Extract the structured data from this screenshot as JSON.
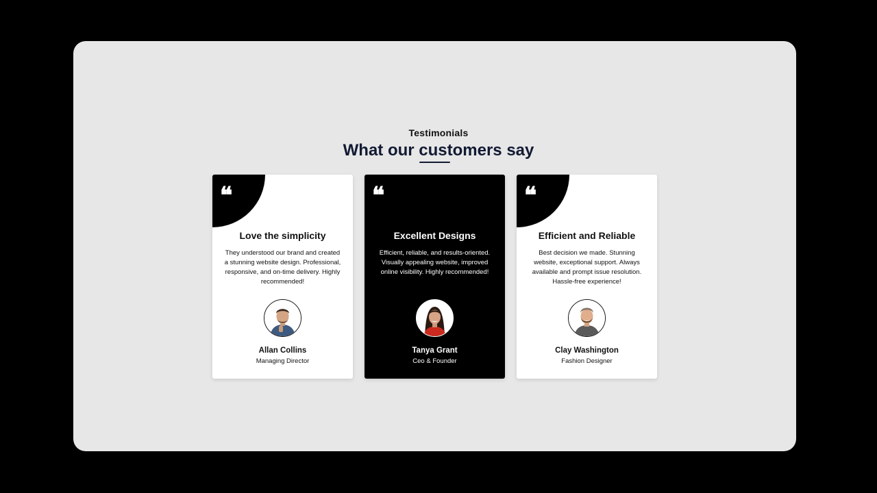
{
  "section": {
    "eyebrow": "Testimonials",
    "title": "What our customers say"
  },
  "testimonials": [
    {
      "title": "Love the simplicity",
      "text": "They understood our brand and created a stunning website design. Professional, responsive, and on-time delivery. Highly recommended!",
      "name": "Allan Collins",
      "role": "Managing Director",
      "theme": "light",
      "quote_icon": "quote-icon"
    },
    {
      "title": "Excellent Designs",
      "text": "Efficient, reliable, and results-oriented. Visually appealing website, improved online visibility. Highly recommended!",
      "name": "Tanya Grant",
      "role": "Ceo & Founder",
      "theme": "dark",
      "quote_icon": "quote-icon"
    },
    {
      "title": "Efficient and Reliable",
      "text": "Best decision we made. Stunning website, exceptional support. Always available and prompt issue resolution. Hassle-free experience!",
      "name": "Clay Washington",
      "role": "Fashion Designer",
      "theme": "light",
      "quote_icon": "quote-icon"
    }
  ],
  "colors": {
    "page_background": "#000000",
    "panel_background": "#e7e7e7",
    "title_color": "#121a33",
    "card_light": "#ffffff",
    "card_dark": "#000000"
  }
}
